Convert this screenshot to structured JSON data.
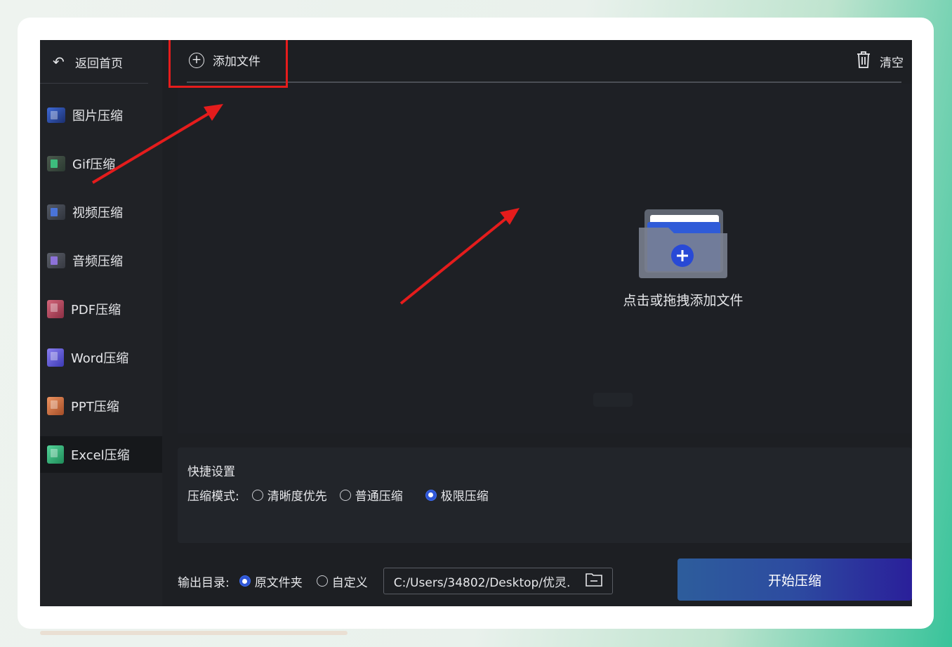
{
  "sidebar": {
    "back_label": "返回首页",
    "items": [
      {
        "label": "图片压缩",
        "icon": "image-compress-icon"
      },
      {
        "label": "Gif压缩",
        "icon": "gif-compress-icon"
      },
      {
        "label": "视频压缩",
        "icon": "video-compress-icon"
      },
      {
        "label": "音频压缩",
        "icon": "audio-compress-icon"
      },
      {
        "label": "PDF压缩",
        "icon": "pdf-compress-icon"
      },
      {
        "label": "Word压缩",
        "icon": "word-compress-icon"
      },
      {
        "label": "PPT压缩",
        "icon": "ppt-compress-icon"
      },
      {
        "label": "Excel压缩",
        "icon": "excel-compress-icon"
      }
    ],
    "active_item": "Excel压缩"
  },
  "toolbar": {
    "add_file_label": "添加文件",
    "clear_label": "清空"
  },
  "dropzone": {
    "hint": "点击或拖拽添加文件"
  },
  "settings": {
    "title": "快捷设置",
    "mode_label": "压缩模式:",
    "modes": [
      {
        "label": "清晰度优先",
        "checked": false
      },
      {
        "label": "普通压缩",
        "checked": false
      },
      {
        "label": "极限压缩",
        "checked": true
      }
    ]
  },
  "output": {
    "label": "输出目录:",
    "options": [
      {
        "label": "原文件夹",
        "checked": true
      },
      {
        "label": "自定义",
        "checked": false
      }
    ],
    "path": "C:/Users/34802/Desktop/优灵."
  },
  "start_button_label": "开始压缩",
  "colors": {
    "annotation": "#e51c1c",
    "accent": "#2f56d6",
    "app_bg": "#1d1f23"
  }
}
